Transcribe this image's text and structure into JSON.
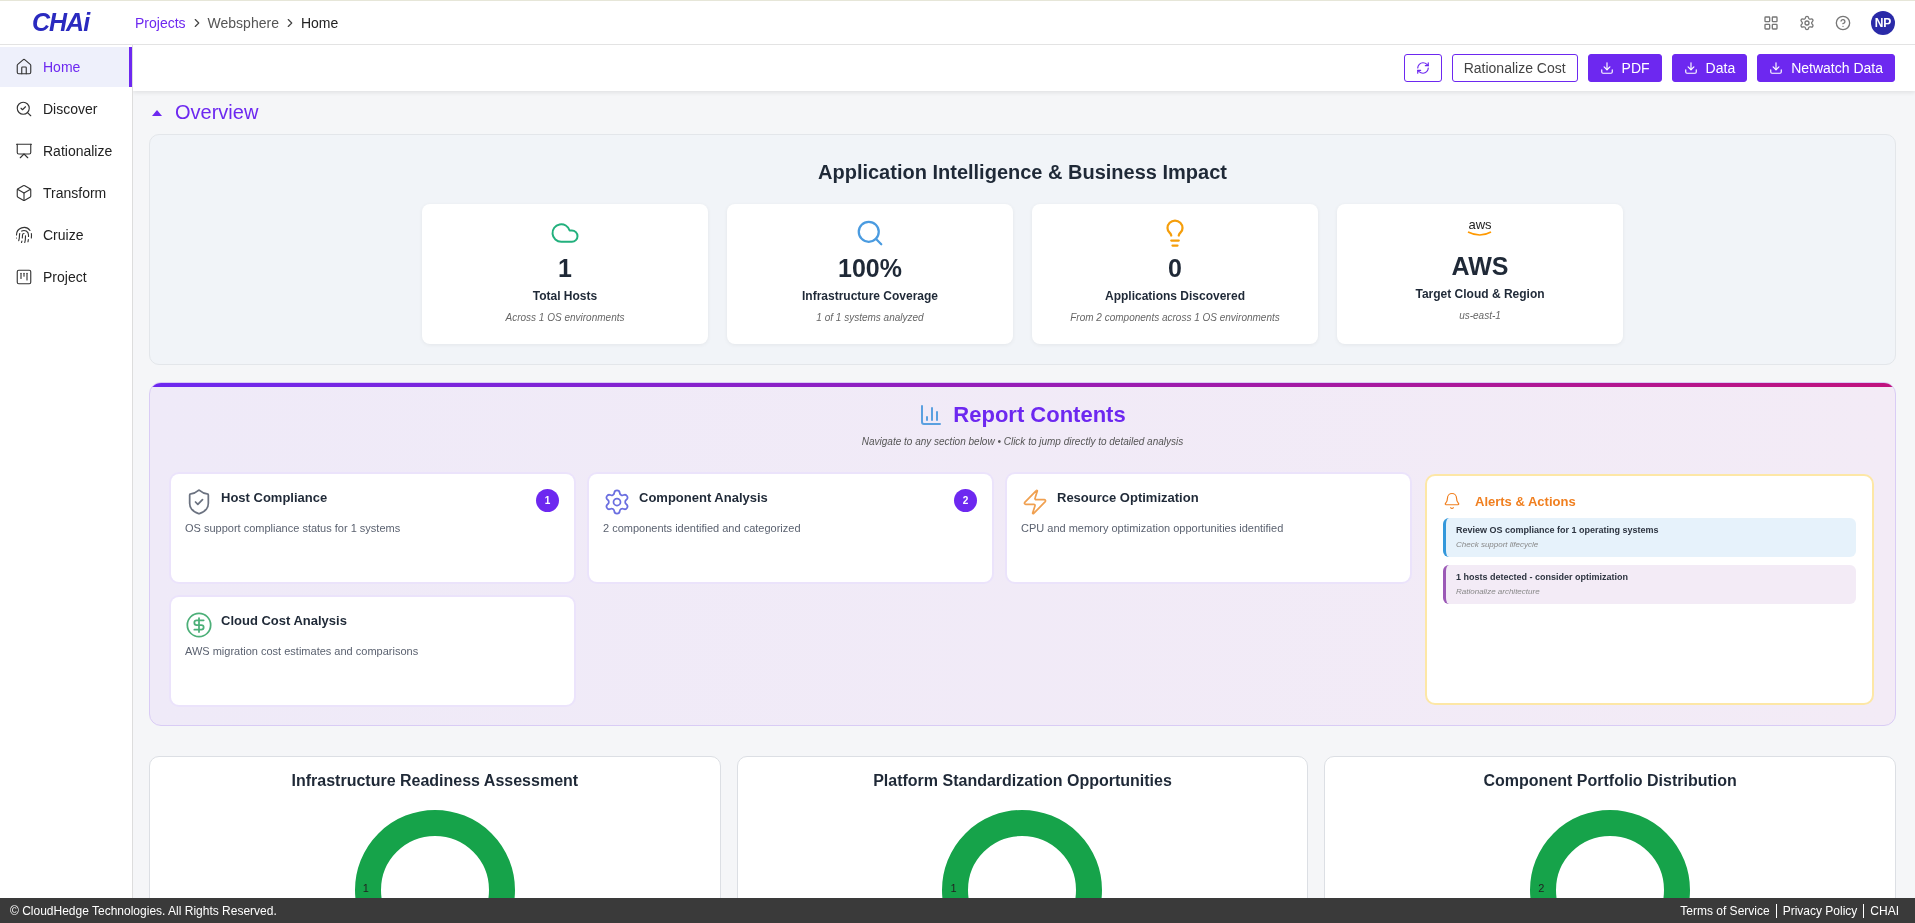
{
  "header": {
    "logo": "CHAi",
    "breadcrumb": [
      {
        "label": "Projects",
        "kind": "link"
      },
      {
        "label": "Websphere",
        "kind": "plain"
      },
      {
        "label": "Home",
        "kind": "current"
      }
    ],
    "avatar": "NP"
  },
  "sidebar": {
    "items": [
      {
        "label": "Home",
        "kind": "home",
        "selected": true
      },
      {
        "label": "Discover",
        "kind": "discover",
        "selected": false
      },
      {
        "label": "Rationalize",
        "kind": "rationalize",
        "selected": false
      },
      {
        "label": "Transform",
        "kind": "transform",
        "selected": false
      },
      {
        "label": "Cruize",
        "kind": "cruize",
        "selected": false
      },
      {
        "label": "Project",
        "kind": "project",
        "selected": false
      }
    ]
  },
  "toolbar": [
    {
      "kind": "refresh"
    },
    {
      "kind": "outline",
      "label": "Rationalize Cost"
    },
    {
      "kind": "download",
      "label": "PDF"
    },
    {
      "kind": "download",
      "label": "Data"
    },
    {
      "kind": "download",
      "label": "Netwatch Data"
    }
  ],
  "overview": {
    "title": "Overview",
    "expanded": true
  },
  "impact": {
    "title": "Application Intelligence & Business Impact",
    "metrics": [
      {
        "kind": "cloud",
        "value": "1",
        "label": "Total Hosts",
        "note": "Across 1 OS environments"
      },
      {
        "kind": "search",
        "value": "100%",
        "label": "Infrastructure Coverage",
        "note": "1 of 1 systems analyzed"
      },
      {
        "kind": "bulb",
        "value": "0",
        "label": "Applications Discovered",
        "note": "From 2 components across 1 OS environments"
      },
      {
        "kind": "aws",
        "logo": "aws",
        "value": "AWS",
        "label": "Target Cloud & Region",
        "note": "us-east-1"
      }
    ]
  },
  "report": {
    "title": "Report Contents",
    "subtitle": "Navigate to any section below • Click to jump directly to detailed analysis",
    "sections": [
      {
        "kind": "shield",
        "title": "Host Compliance",
        "description": "OS support compliance status for 1 systems",
        "badge": "1"
      },
      {
        "kind": "gear",
        "title": "Component Analysis",
        "description": "2 components identified and categorized",
        "badge": "2"
      },
      {
        "kind": "bolt",
        "title": "Resource Optimization",
        "description": "CPU and memory optimization opportunities identified"
      },
      {
        "kind": "dollar",
        "title": "Cloud Cost Analysis",
        "description": "AWS migration cost estimates and comparisons"
      }
    ],
    "alerts": {
      "title": "Alerts & Actions",
      "items": [
        {
          "title": "Review OS compliance for 1 operating systems",
          "note": "Check support lifecycle",
          "color": "#3498db"
        },
        {
          "title": "1 hosts detected - consider optimization",
          "note": "Rationalize architecture",
          "color": "#9b59b6"
        }
      ]
    }
  },
  "charts": [
    {
      "title": "Infrastructure Readiness Assessment",
      "label": "1"
    },
    {
      "title": "Platform Standardization Opportunities",
      "label": "1"
    },
    {
      "title": "Component Portfolio Distribution",
      "label": "2"
    }
  ],
  "footer": {
    "copyright": "© CloudHedge Technologies. All Rights Reserved.",
    "links": [
      "Terms of Service",
      "Privacy Policy",
      "CHAI"
    ]
  }
}
